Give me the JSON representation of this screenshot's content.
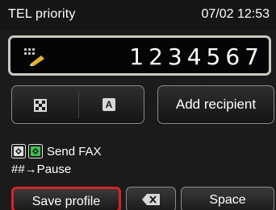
{
  "status": {
    "mode": "TEL priority",
    "datetime": "07/02 12:53"
  },
  "number_field": {
    "value": "1234567"
  },
  "buttons": {
    "add_recipient": "Add recipient",
    "save_profile": "Save profile",
    "space": "Space"
  },
  "hints": {
    "send_fax": "Send FAX",
    "pause": "##→Pause"
  },
  "icons": {
    "keyboard": "keyboard-icon",
    "checker": "checker-icon",
    "alpha": "A",
    "start_mono": "start-mono-icon",
    "start_color": "start-color-icon",
    "backspace": "backspace-icon"
  },
  "colors": {
    "focus": "#d8232a",
    "start_color": "#3fbf4f"
  }
}
